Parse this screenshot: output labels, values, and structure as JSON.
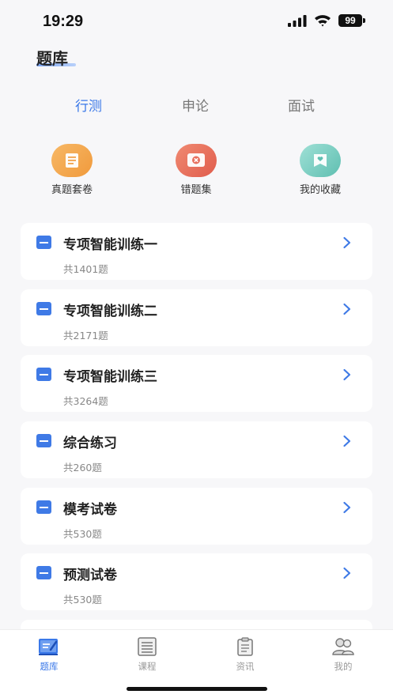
{
  "status_bar": {
    "time": "19:29",
    "battery": "99"
  },
  "header": {
    "title": "题库"
  },
  "tabs": [
    {
      "label": "行测",
      "active": true
    },
    {
      "label": "申论",
      "active": false
    },
    {
      "label": "面试",
      "active": false
    }
  ],
  "shortcuts": [
    {
      "label": "真题套卷",
      "icon": "document-icon",
      "color": "#f2a24b"
    },
    {
      "label": "错题集",
      "icon": "error-book-icon",
      "color": "#e8705e"
    },
    {
      "label": "我的收藏",
      "icon": "favorite-icon",
      "color": "#7fd0c4"
    }
  ],
  "cards": [
    {
      "title": "专项智能训练一",
      "count": "共1401题"
    },
    {
      "title": "专项智能训练二",
      "count": "共2171题"
    },
    {
      "title": "专项智能训练三",
      "count": "共3264题"
    },
    {
      "title": "综合练习",
      "count": "共260题"
    },
    {
      "title": "模考试卷",
      "count": "共530题"
    },
    {
      "title": "预测试卷",
      "count": "共530题"
    }
  ],
  "tabbar": [
    {
      "label": "题库",
      "icon": "question-bank-icon",
      "active": true
    },
    {
      "label": "课程",
      "icon": "course-icon",
      "active": false
    },
    {
      "label": "资讯",
      "icon": "news-icon",
      "active": false
    },
    {
      "label": "我的",
      "icon": "profile-icon",
      "active": false
    }
  ],
  "colors": {
    "accent": "#3a78e8",
    "card_icon": "#3f7ae6"
  }
}
